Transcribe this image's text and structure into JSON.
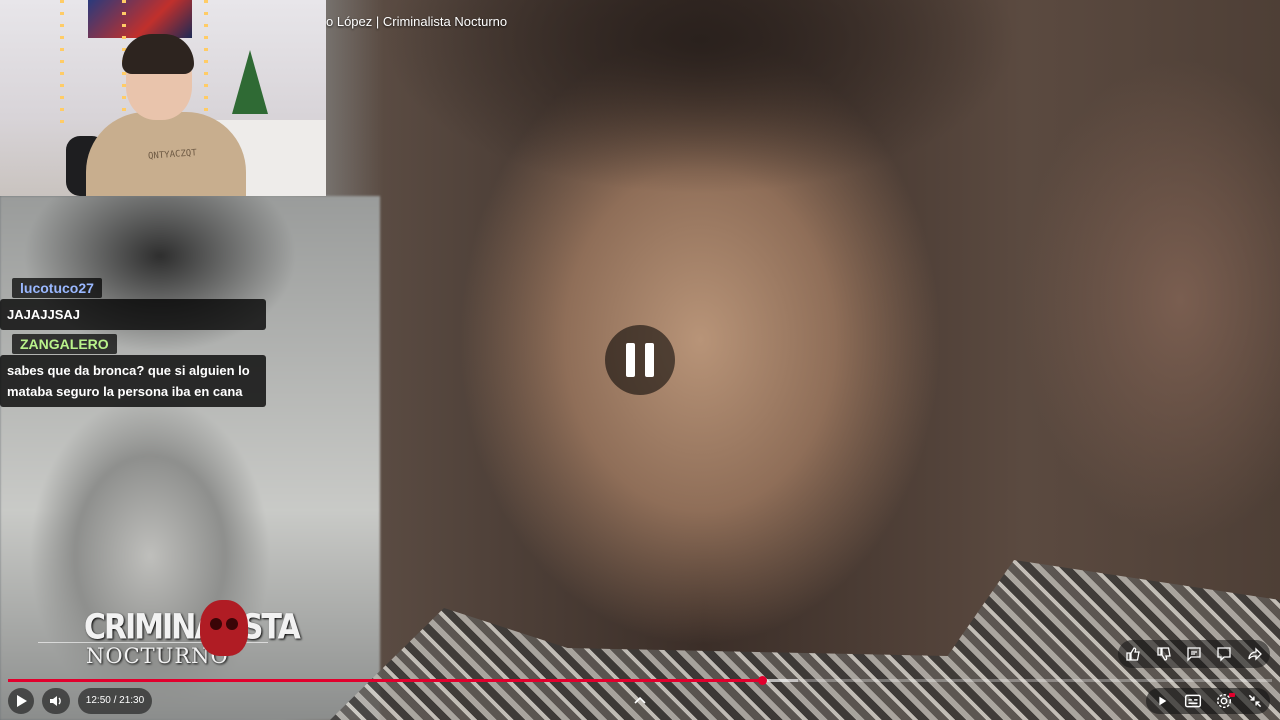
{
  "video": {
    "title": "o López | Criminalista Nocturno",
    "logo": {
      "line1": "CRIMINALISTA",
      "line2": "NOCTURNO"
    }
  },
  "webcam": {
    "hoodie_text": "QNTYACZQT"
  },
  "chat": {
    "messages": [
      {
        "user": "lucotuco27",
        "user_color": "#9ab8ff",
        "text": "JAJAJJSAJ"
      },
      {
        "user": "ZANGALERO",
        "user_color": "#b9f28b",
        "text": "sabes que da bronca? que si alguien lo mataba seguro la persona iba en cana"
      }
    ]
  },
  "player": {
    "state": "paused",
    "time_display": "12:50 / 21:30",
    "progress_fraction": 0.5969,
    "buffered_fraction": 0.625,
    "accent_color": "#e1002d",
    "controls_left": [
      "play-icon",
      "volume-icon"
    ],
    "actions_right": [
      "like-icon",
      "dislike-icon",
      "comment-icon",
      "chat-icon",
      "share-icon"
    ],
    "controls_right": [
      "autoplay-icon",
      "subtitles-icon",
      "settings-icon",
      "exit-fullscreen-icon"
    ],
    "center_toggle": "chevron-up-icon"
  }
}
